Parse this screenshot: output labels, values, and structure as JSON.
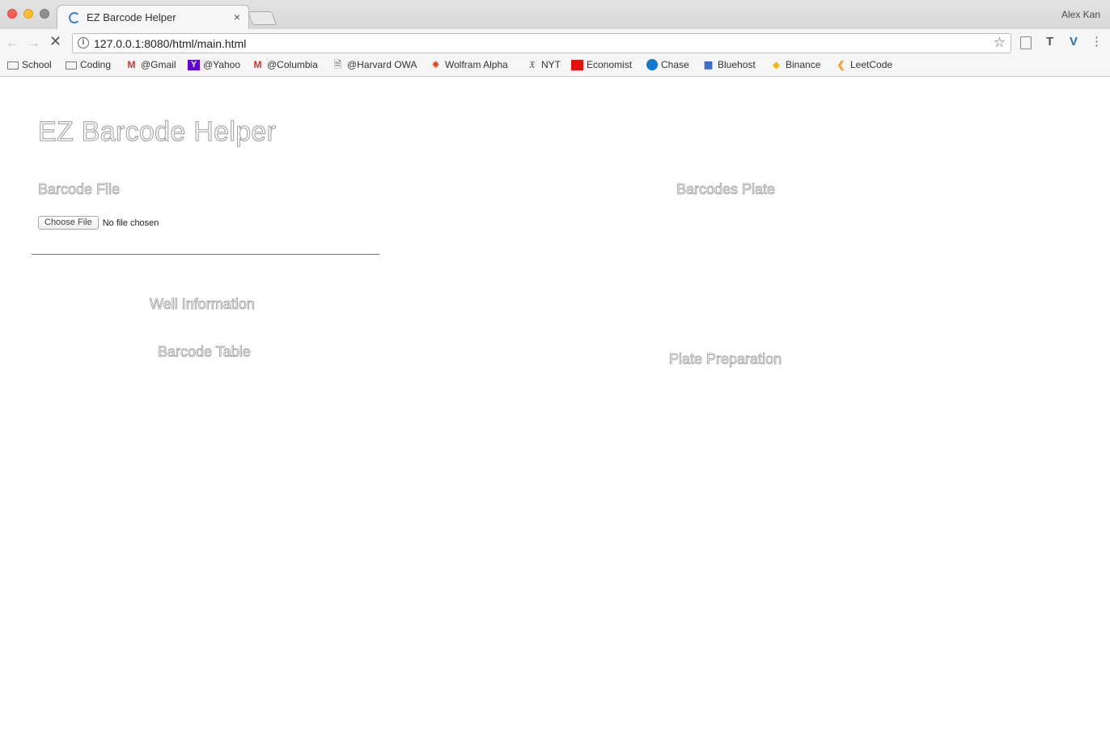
{
  "browser": {
    "tab_title": "EZ Barcode Helper",
    "tab_close": "×",
    "profile_name": "Alex Kan",
    "url": "127.0.0.1:8080/html/main.html"
  },
  "bookmarks": [
    {
      "label": "School",
      "icon": "folder-icon"
    },
    {
      "label": "Coding",
      "icon": "folder-icon"
    },
    {
      "label": "@Gmail",
      "icon": "gmail-icon"
    },
    {
      "label": "@Yahoo",
      "icon": "yahoo-icon"
    },
    {
      "label": "@Columbia",
      "icon": "gmail-icon"
    },
    {
      "label": "@Harvard OWA",
      "icon": "document-icon"
    },
    {
      "label": "Wolfram Alpha",
      "icon": "wolfram-icon"
    },
    {
      "label": "NYT",
      "icon": "nyt-icon"
    },
    {
      "label": "Economist",
      "icon": "economist-icon"
    },
    {
      "label": "Chase",
      "icon": "chase-icon"
    },
    {
      "label": "Bluehost",
      "icon": "bluehost-icon"
    },
    {
      "label": "Binance",
      "icon": "binance-icon"
    },
    {
      "label": "LeetCode",
      "icon": "leetcode-icon"
    }
  ],
  "page": {
    "title": "EZ Barcode Helper",
    "barcode_file_label": "Barcode File",
    "choose_file_button": "Choose File",
    "no_file_text": "No file chosen",
    "barcode_plate_label": "Barcodes Plate",
    "well_information_label": "Well Information",
    "barcode_table_label": "Barcode Table",
    "plate_preparation_label": "Plate Preparation"
  }
}
